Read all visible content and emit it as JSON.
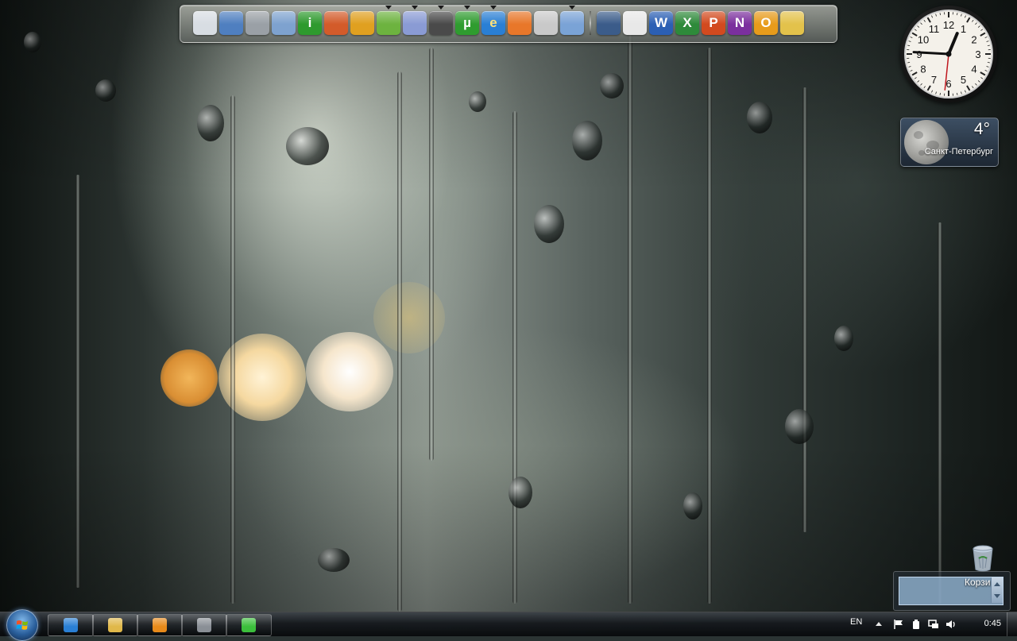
{
  "dock": {
    "items": [
      {
        "name": "dock-app-1",
        "glyph": "",
        "bg": "#d8dde3",
        "fg": "#2d4f7c"
      },
      {
        "name": "dock-app-2",
        "glyph": "",
        "bg": "#4f7fc0",
        "fg": "#ffffff"
      },
      {
        "name": "dock-app-3",
        "glyph": "",
        "bg": "#9aa0a6",
        "fg": "#333333"
      },
      {
        "name": "dock-app-4",
        "glyph": "",
        "bg": "#7ea2cf",
        "fg": "#ffffff"
      },
      {
        "name": "dock-app-info",
        "glyph": "i",
        "bg": "#2e9a2e",
        "fg": "#ffffff"
      },
      {
        "name": "dock-app-6",
        "glyph": "",
        "bg": "#d35b2a",
        "fg": "#ffffff"
      },
      {
        "name": "dock-app-7",
        "glyph": "",
        "bg": "#e0a020",
        "fg": "#7a1f10"
      },
      {
        "name": "dock-app-8",
        "glyph": "",
        "bg": "#6db33f",
        "fg": "#ffffff",
        "marker": true
      },
      {
        "name": "dock-app-9",
        "glyph": "",
        "bg": "#8a9bd4",
        "fg": "#ffffff",
        "marker": true
      },
      {
        "name": "dock-app-10",
        "glyph": "",
        "bg": "#4a4a4a",
        "fg": "#dddddd",
        "marker": true
      },
      {
        "name": "dock-app-utorrent",
        "glyph": "µ",
        "bg": "#2f9c2f",
        "fg": "#ffffff",
        "marker": true
      },
      {
        "name": "dock-app-internet-explorer",
        "glyph": "e",
        "bg": "#2a7fd4",
        "fg": "#ffe27a",
        "marker": true
      },
      {
        "name": "dock-app-firefox",
        "glyph": "",
        "bg": "#e8772a",
        "fg": "#ffffff"
      },
      {
        "name": "dock-app-14",
        "glyph": "",
        "bg": "#c9c9c9",
        "fg": "#333333"
      },
      {
        "name": "dock-app-15",
        "glyph": "",
        "bg": "#7aa3d6",
        "fg": "#ffffff",
        "marker": true
      },
      {
        "sep": true
      },
      {
        "name": "dock-app-17",
        "glyph": "",
        "bg": "#3b5c8a",
        "fg": "#ffffff"
      },
      {
        "name": "dock-app-18",
        "glyph": "",
        "bg": "#e8e8e8",
        "fg": "#c0272d"
      },
      {
        "name": "dock-app-word",
        "glyph": "W",
        "bg": "#2b5fb4",
        "fg": "#ffffff"
      },
      {
        "name": "dock-app-excel",
        "glyph": "X",
        "bg": "#2e8a3a",
        "fg": "#ffffff"
      },
      {
        "name": "dock-app-powerpoint",
        "glyph": "P",
        "bg": "#d24a1f",
        "fg": "#ffffff"
      },
      {
        "name": "dock-app-onenote",
        "glyph": "N",
        "bg": "#7b2f9e",
        "fg": "#ffffff"
      },
      {
        "name": "dock-app-outlook",
        "glyph": "O",
        "bg": "#e79b1b",
        "fg": "#ffffff"
      },
      {
        "name": "dock-app-24",
        "glyph": "",
        "bg": "#e3c24b",
        "fg": "#555555"
      }
    ]
  },
  "clock": {
    "hour": 12,
    "minute": 45,
    "second": 31
  },
  "weather": {
    "temperature": "4°",
    "city": "Санкт-Петербург"
  },
  "recycle_bin": {
    "label": "Корзина"
  },
  "taskbar": {
    "buttons": [
      {
        "name": "taskbar-internet-explorer",
        "color": "#2a7fd4"
      },
      {
        "name": "taskbar-explorer",
        "color": "#e0b84a"
      },
      {
        "name": "taskbar-media-player",
        "color": "#e88a1a"
      },
      {
        "name": "taskbar-app-4",
        "color": "#8a8f96"
      },
      {
        "name": "taskbar-app-5",
        "color": "#3cbf3c"
      }
    ],
    "language": "EN",
    "time": "0:45"
  }
}
